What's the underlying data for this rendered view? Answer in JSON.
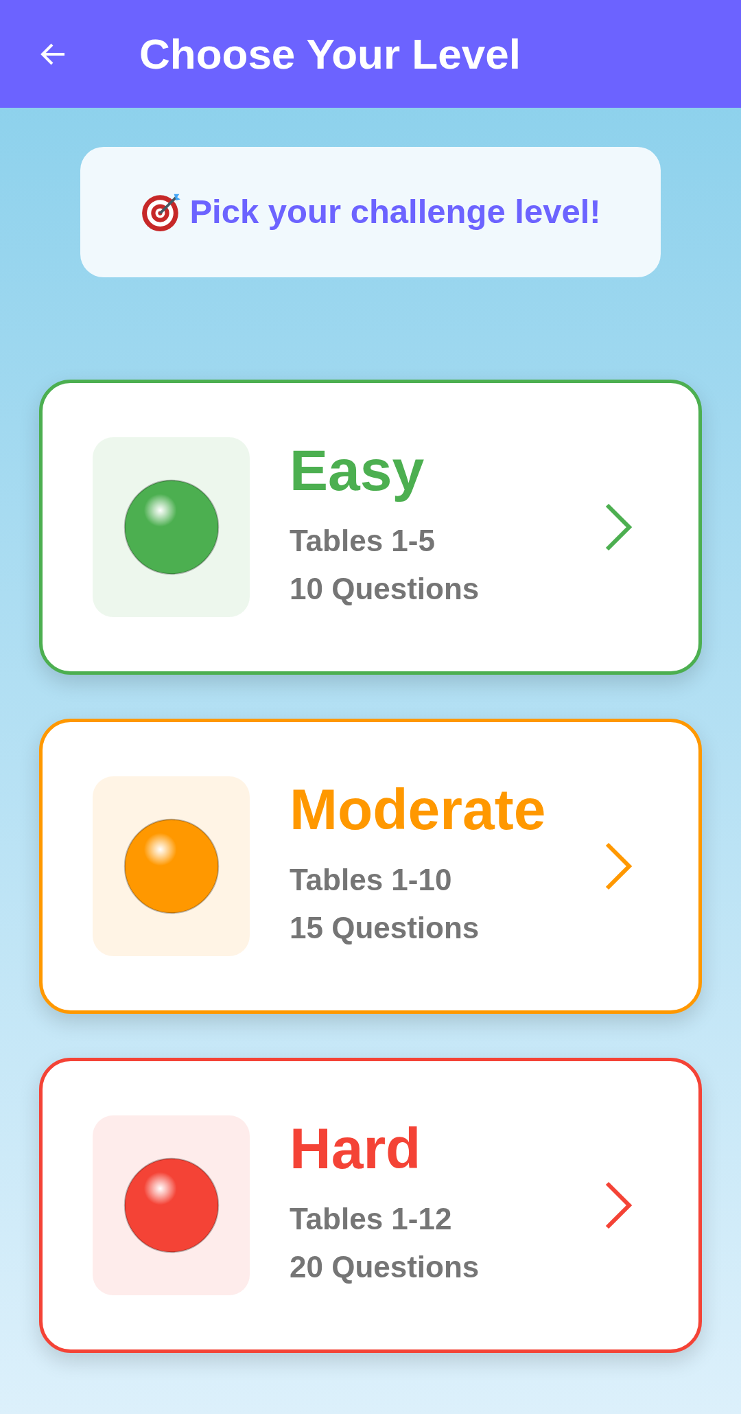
{
  "header": {
    "title": "Choose Your Level"
  },
  "banner": {
    "text": "Pick your challenge level!"
  },
  "levels": [
    {
      "title": "Easy",
      "tables": "Tables 1-5",
      "questions": "10 Questions",
      "color": "#4caf50"
    },
    {
      "title": "Moderate",
      "tables": "Tables 1-10",
      "questions": "15 Questions",
      "color": "#ff9800"
    },
    {
      "title": "Hard",
      "tables": "Tables 1-12",
      "questions": "20 Questions",
      "color": "#f44336"
    }
  ]
}
